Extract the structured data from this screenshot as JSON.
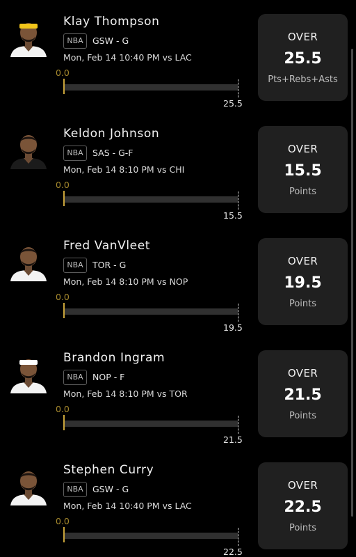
{
  "colors": {
    "background": "#000000",
    "card": "#202020",
    "accent_gold": "#c9a43a",
    "track": "#303030"
  },
  "picks": [
    {
      "player": "Klay Thompson",
      "league": "NBA",
      "team_pos": "GSW - G",
      "game": "Mon, Feb 14 10:40 PM vs LAC",
      "progress_start": "0.0",
      "progress_fraction": 0,
      "line_label": "25.5",
      "direction": "OVER",
      "line": "25.5",
      "stat": "Pts+Rebs+Asts",
      "avatar_icon": "player-headshot-icon",
      "jersey_color": "#f3f3f3",
      "headwear_color": "#f2c51a"
    },
    {
      "player": "Keldon Johnson",
      "league": "NBA",
      "team_pos": "SAS - G-F",
      "game": "Mon, Feb 14 8:10 PM vs CHI",
      "progress_start": "0.0",
      "progress_fraction": 0,
      "line_label": "15.5",
      "direction": "OVER",
      "line": "15.5",
      "stat": "Points",
      "avatar_icon": "player-headshot-icon",
      "jersey_color": "#1b1b1b",
      "headwear_color": ""
    },
    {
      "player": "Fred VanVleet",
      "league": "NBA",
      "team_pos": "TOR - G",
      "game": "Mon, Feb 14 8:10 PM vs NOP",
      "progress_start": "0.0",
      "progress_fraction": 0,
      "line_label": "19.5",
      "direction": "OVER",
      "line": "19.5",
      "stat": "Points",
      "avatar_icon": "player-headshot-icon",
      "jersey_color": "#f3f3f3",
      "headwear_color": ""
    },
    {
      "player": "Brandon Ingram",
      "league": "NBA",
      "team_pos": "NOP - F",
      "game": "Mon, Feb 14 8:10 PM vs TOR",
      "progress_start": "0.0",
      "progress_fraction": 0,
      "line_label": "21.5",
      "direction": "OVER",
      "line": "21.5",
      "stat": "Points",
      "avatar_icon": "player-headshot-icon",
      "jersey_color": "#f3f3f3",
      "headwear_color": "#ffffff"
    },
    {
      "player": "Stephen Curry",
      "league": "NBA",
      "team_pos": "GSW - G",
      "game": "Mon, Feb 14 10:40 PM vs LAC",
      "progress_start": "0.0",
      "progress_fraction": 0,
      "line_label": "22.5",
      "direction": "OVER",
      "line": "22.5",
      "stat": "Points",
      "avatar_icon": "player-headshot-icon",
      "jersey_color": "#f3f3f3",
      "headwear_color": ""
    }
  ]
}
